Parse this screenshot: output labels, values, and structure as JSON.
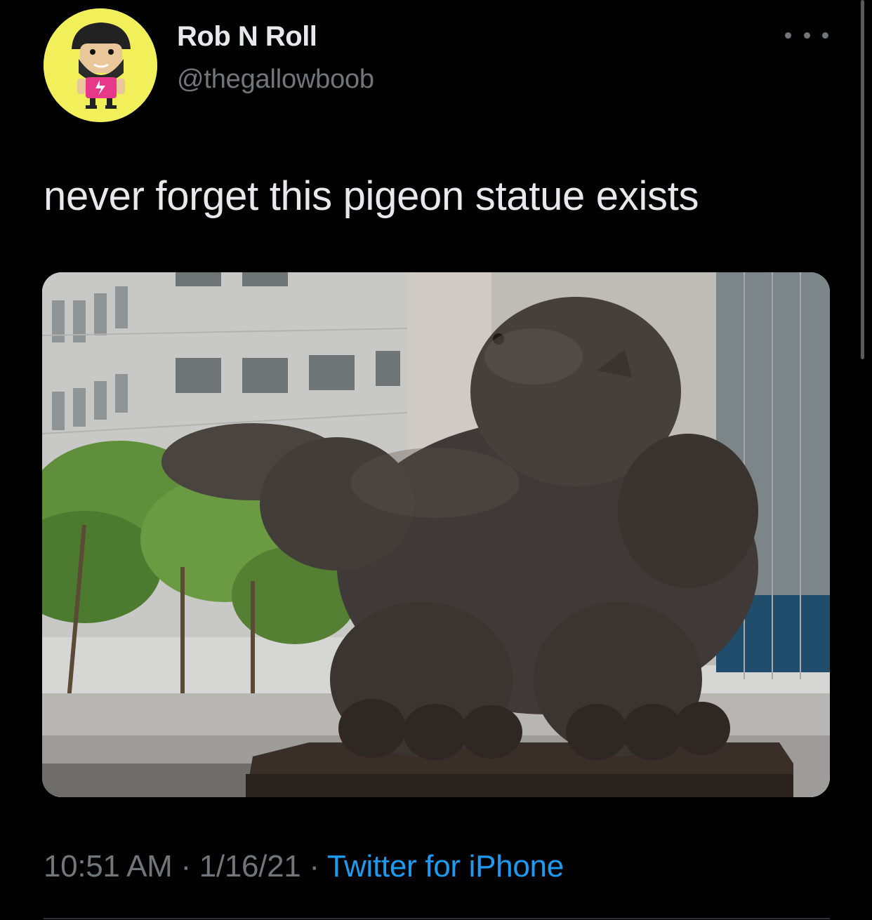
{
  "tweet": {
    "author": {
      "display_name": "Rob N Roll",
      "handle": "@thegallowboob",
      "avatar_icon": "cartoon-avatar",
      "avatar_bg": "#f2f05a"
    },
    "more_icon": "ellipsis-icon",
    "text": "never forget this pigeon statue exists",
    "media": {
      "description_icon": "photo"
    },
    "time": "10:51 AM",
    "date": "1/16/21",
    "separator": "·",
    "source": "Twitter for iPhone"
  },
  "colors": {
    "background": "#000000",
    "primary_text": "#e7e9ea",
    "secondary_text": "#71767b",
    "link": "#1d9bf0"
  }
}
